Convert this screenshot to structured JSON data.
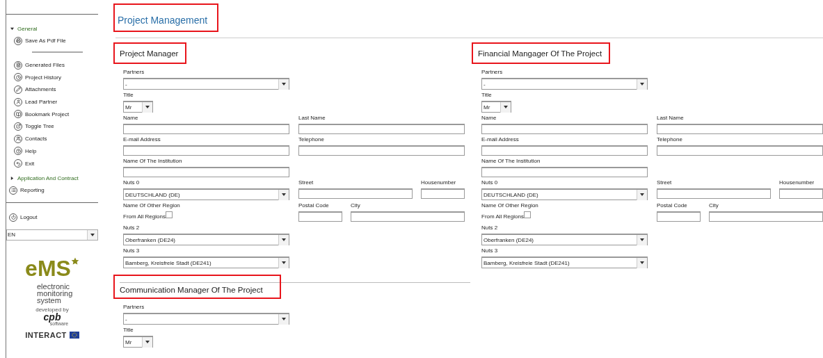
{
  "sidebar": {
    "groups": [
      {
        "label": "General",
        "expanded": true,
        "item_groups": [
          [
            "Save As Pdf File"
          ],
          [
            "Generated Files",
            "Project History",
            "Attachments",
            "Lead Partner",
            "Bookmark Project",
            "Toggle Tree",
            "Contacts",
            "Help",
            "Exit"
          ]
        ]
      },
      {
        "label": "Application And Contract",
        "expanded": false
      }
    ],
    "bottom_items": [
      "Reporting"
    ],
    "logout": "Logout",
    "language": {
      "value": "EN"
    },
    "logo": {
      "mark": "eMS",
      "tagline": "electronic monitoring system",
      "developer_prefix": "developed by",
      "developer": "cpb",
      "developer_suffix": "software",
      "partner": "INTERACT"
    }
  },
  "page": {
    "title": "Project Management",
    "highlighted": true
  },
  "sections": [
    {
      "heading": "Project Manager",
      "highlighted": true,
      "divider": false,
      "partners": {
        "label": "Partners",
        "value": "-"
      },
      "title": {
        "label": "Title",
        "value": "Mr"
      },
      "name": {
        "label": "Name"
      },
      "last_name": {
        "label": "Last Name"
      },
      "email": {
        "label": "E-mail Address"
      },
      "telephone": {
        "label": "Telephone"
      },
      "institution": {
        "label": "Name Of The Institution"
      },
      "nuts0": {
        "label": "Nuts 0",
        "value": "DEUTSCHLAND (DE)"
      },
      "street": {
        "label": "Street"
      },
      "housenumber": {
        "label": "Housenumber"
      },
      "other_region": {
        "label": "Name Of Other Region"
      },
      "from_all_regions": {
        "label": "From All Regions",
        "checked": false
      },
      "postal_code": {
        "label": "Postal Code"
      },
      "city": {
        "label": "City"
      },
      "nuts2": {
        "label": "Nuts 2",
        "value": "Oberfranken (DE24)"
      },
      "nuts3": {
        "label": "Nuts 3",
        "value": "Bamberg, Kreisfreie Stadt (DE241)"
      }
    },
    {
      "heading": "Financial Mangager Of The Project",
      "highlighted": true,
      "divider": false,
      "partners": {
        "label": "Partners",
        "value": "-"
      },
      "title": {
        "label": "Title",
        "value": "Mr"
      },
      "name": {
        "label": "Name"
      },
      "last_name": {
        "label": "Last Name"
      },
      "email": {
        "label": "E-mail Address"
      },
      "telephone": {
        "label": "Telephone"
      },
      "institution": {
        "label": "Name Of The Institution"
      },
      "nuts0": {
        "label": "Nuts 0",
        "value": "DEUTSCHLAND (DE)"
      },
      "street": {
        "label": "Street"
      },
      "housenumber": {
        "label": "Housenumber"
      },
      "other_region": {
        "label": "Name Of Other Region"
      },
      "from_all_regions": {
        "label": "From All Regions",
        "checked": false
      },
      "postal_code": {
        "label": "Postal Code"
      },
      "city": {
        "label": "City"
      },
      "nuts2": {
        "label": "Nuts 2",
        "value": "Oberfranken (DE24)"
      },
      "nuts3": {
        "label": "Nuts 3",
        "value": "Bamberg, Kreisfreie Stadt (DE241)"
      }
    },
    {
      "heading": "Communication Manager Of The Project",
      "highlighted": true,
      "divider": true,
      "partners": {
        "label": "Partners",
        "value": "-"
      },
      "title": {
        "label": "Title",
        "value": "Mr"
      }
    }
  ]
}
